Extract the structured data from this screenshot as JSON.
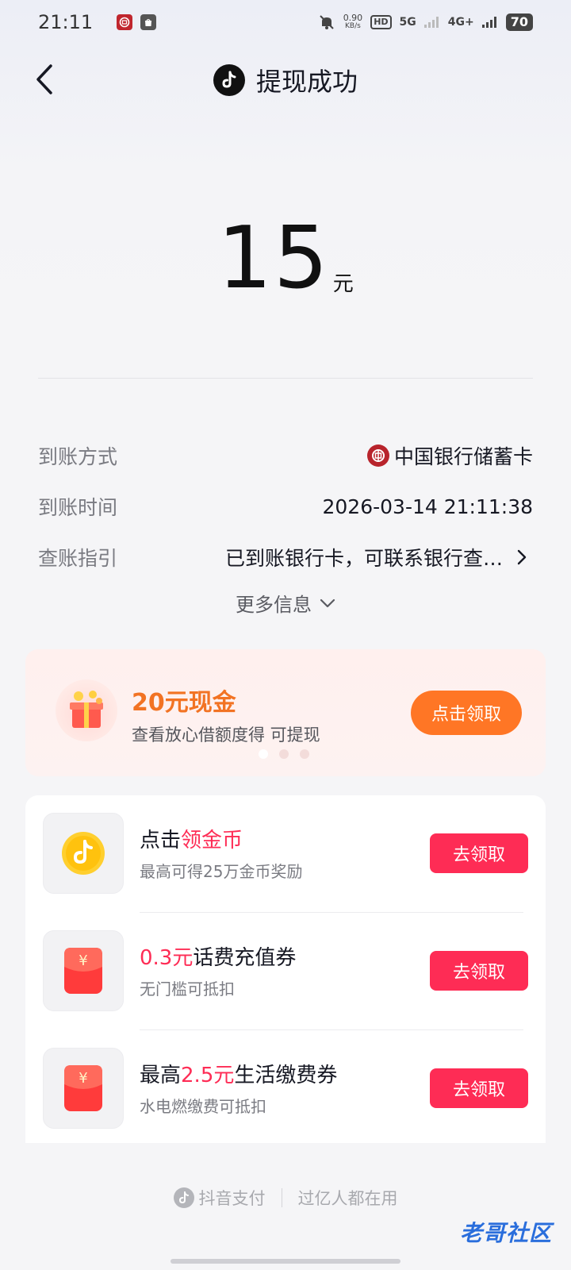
{
  "status_bar": {
    "time": "21:11",
    "speed_value": "0.90",
    "speed_unit": "KB/s",
    "hd": "HD",
    "net1": "5G",
    "net2": "4G+",
    "battery": "70"
  },
  "header": {
    "title": "提现成功"
  },
  "amount": {
    "value": "15",
    "unit": "元"
  },
  "details": {
    "method_label": "到账方式",
    "method_value": "中国银行储蓄卡",
    "time_label": "到账时间",
    "time_value": "2026-03-14 21:11:38",
    "guide_label": "查账指引",
    "guide_value": "已到账银行卡，可联系银行查…"
  },
  "more_info": "更多信息",
  "promo": {
    "title": "20元现金",
    "subtitle": "查看放心借额度得 可提现",
    "button": "点击领取",
    "dots_total": 3,
    "dots_active": 1
  },
  "tasks": [
    {
      "title_pre": "点击",
      "title_hl": "领金币",
      "title_post": "",
      "subtitle": "最高可得25万金币奖励",
      "button": "去领取",
      "icon": "gold-coin-icon"
    },
    {
      "title_pre": "",
      "title_hl": "0.3元",
      "title_post": "话费充值券",
      "subtitle": "无门槛可抵扣",
      "button": "去领取",
      "icon": "red-envelope-icon"
    },
    {
      "title_pre": "最高",
      "title_hl": "2.5元",
      "title_post": "生活缴费券",
      "subtitle": "水电燃缴费可抵扣",
      "button": "去领取",
      "icon": "red-envelope-icon"
    }
  ],
  "footer": {
    "brand": "抖音支付",
    "slogan": "过亿人都在用"
  },
  "watermark": "老哥社区",
  "colors": {
    "accent_red": "#fe2c55",
    "promo_orange": "#ff7625",
    "bank_red": "#b8242c"
  }
}
